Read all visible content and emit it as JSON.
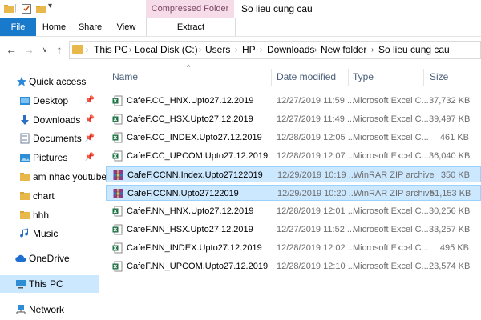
{
  "window": {
    "title": "So lieu cung cau",
    "contextual_tab_group": "Compressed Folder Tools"
  },
  "ribbon": {
    "tabs": [
      "File",
      "Home",
      "Share",
      "View",
      "Extract"
    ]
  },
  "address": {
    "crumbs": [
      "This PC",
      "Local Disk (C:)",
      "Users",
      "HP",
      "Downloads",
      "New folder",
      "So lieu cung cau"
    ]
  },
  "nav": {
    "items": [
      {
        "label": "Quick access",
        "icon": "star-icon",
        "pinned": false
      },
      {
        "label": "Desktop",
        "icon": "desktop-folder-icon",
        "pinned": true
      },
      {
        "label": "Downloads",
        "icon": "download-arrow-icon",
        "pinned": true
      },
      {
        "label": "Documents",
        "icon": "documents-icon",
        "pinned": true
      },
      {
        "label": "Pictures",
        "icon": "pictures-icon",
        "pinned": true
      },
      {
        "label": "am nhac youtube",
        "icon": "folder-icon",
        "pinned": false
      },
      {
        "label": "chart",
        "icon": "folder-icon",
        "pinned": false
      },
      {
        "label": "hhh",
        "icon": "folder-icon",
        "pinned": false
      },
      {
        "label": "Music",
        "icon": "music-note-icon",
        "pinned": false
      },
      {
        "label": "OneDrive",
        "icon": "cloud-icon",
        "pinned": false
      },
      {
        "label": "This PC",
        "icon": "computer-icon",
        "pinned": false
      },
      {
        "label": "Network",
        "icon": "network-icon",
        "pinned": false
      }
    ]
  },
  "columns": {
    "name": "Name",
    "date": "Date modified",
    "type": "Type",
    "size": "Size"
  },
  "files": [
    {
      "name": "CafeF.CC_HNX.Upto27.12.2019",
      "date": "12/27/2019 11:59 ...",
      "type": "Microsoft Excel C...",
      "size": "37,732 KB",
      "icon": "excel-icon",
      "selected": false
    },
    {
      "name": "CafeF.CC_HSX.Upto27.12.2019",
      "date": "12/27/2019 11:49 ...",
      "type": "Microsoft Excel C...",
      "size": "39,497 KB",
      "icon": "excel-icon",
      "selected": false
    },
    {
      "name": "CafeF.CC_INDEX.Upto27.12.2019",
      "date": "12/28/2019 12:05 ...",
      "type": "Microsoft Excel C...",
      "size": "461 KB",
      "icon": "excel-icon",
      "selected": false
    },
    {
      "name": "CafeF.CC_UPCOM.Upto27.12.2019",
      "date": "12/28/2019 12:07 ...",
      "type": "Microsoft Excel C...",
      "size": "36,040 KB",
      "icon": "excel-icon",
      "selected": false
    },
    {
      "name": "CafeF.CCNN.Index.Upto27122019",
      "date": "12/29/2019 10:19 ...",
      "type": "WinRAR ZIP archive",
      "size": "350 KB",
      "icon": "winrar-icon",
      "selected": true
    },
    {
      "name": "CafeF.CCNN.Upto27122019",
      "date": "12/29/2019 10:20 ...",
      "type": "WinRAR ZIP archive",
      "size": "51,153 KB",
      "icon": "winrar-icon",
      "selected": true
    },
    {
      "name": "CafeF.NN_HNX.Upto27.12.2019",
      "date": "12/28/2019 12:01 ...",
      "type": "Microsoft Excel C...",
      "size": "30,256 KB",
      "icon": "excel-icon",
      "selected": false
    },
    {
      "name": "CafeF.NN_HSX.Upto27.12.2019",
      "date": "12/27/2019 11:52 ...",
      "type": "Microsoft Excel C...",
      "size": "33,257 KB",
      "icon": "excel-icon",
      "selected": false
    },
    {
      "name": "CafeF.NN_INDEX.Upto27.12.2019",
      "date": "12/28/2019 12:02 ...",
      "type": "Microsoft Excel C...",
      "size": "495 KB",
      "icon": "excel-icon",
      "selected": false
    },
    {
      "name": "CafeF.NN_UPCOM.Upto27.12.2019",
      "date": "12/28/2019 12:10 ...",
      "type": "Microsoft Excel C...",
      "size": "23,574 KB",
      "icon": "excel-icon",
      "selected": false
    }
  ],
  "colors": {
    "accent": "#1979ca",
    "selection": "#cce8ff",
    "context_tab": "#f6dbe9"
  }
}
